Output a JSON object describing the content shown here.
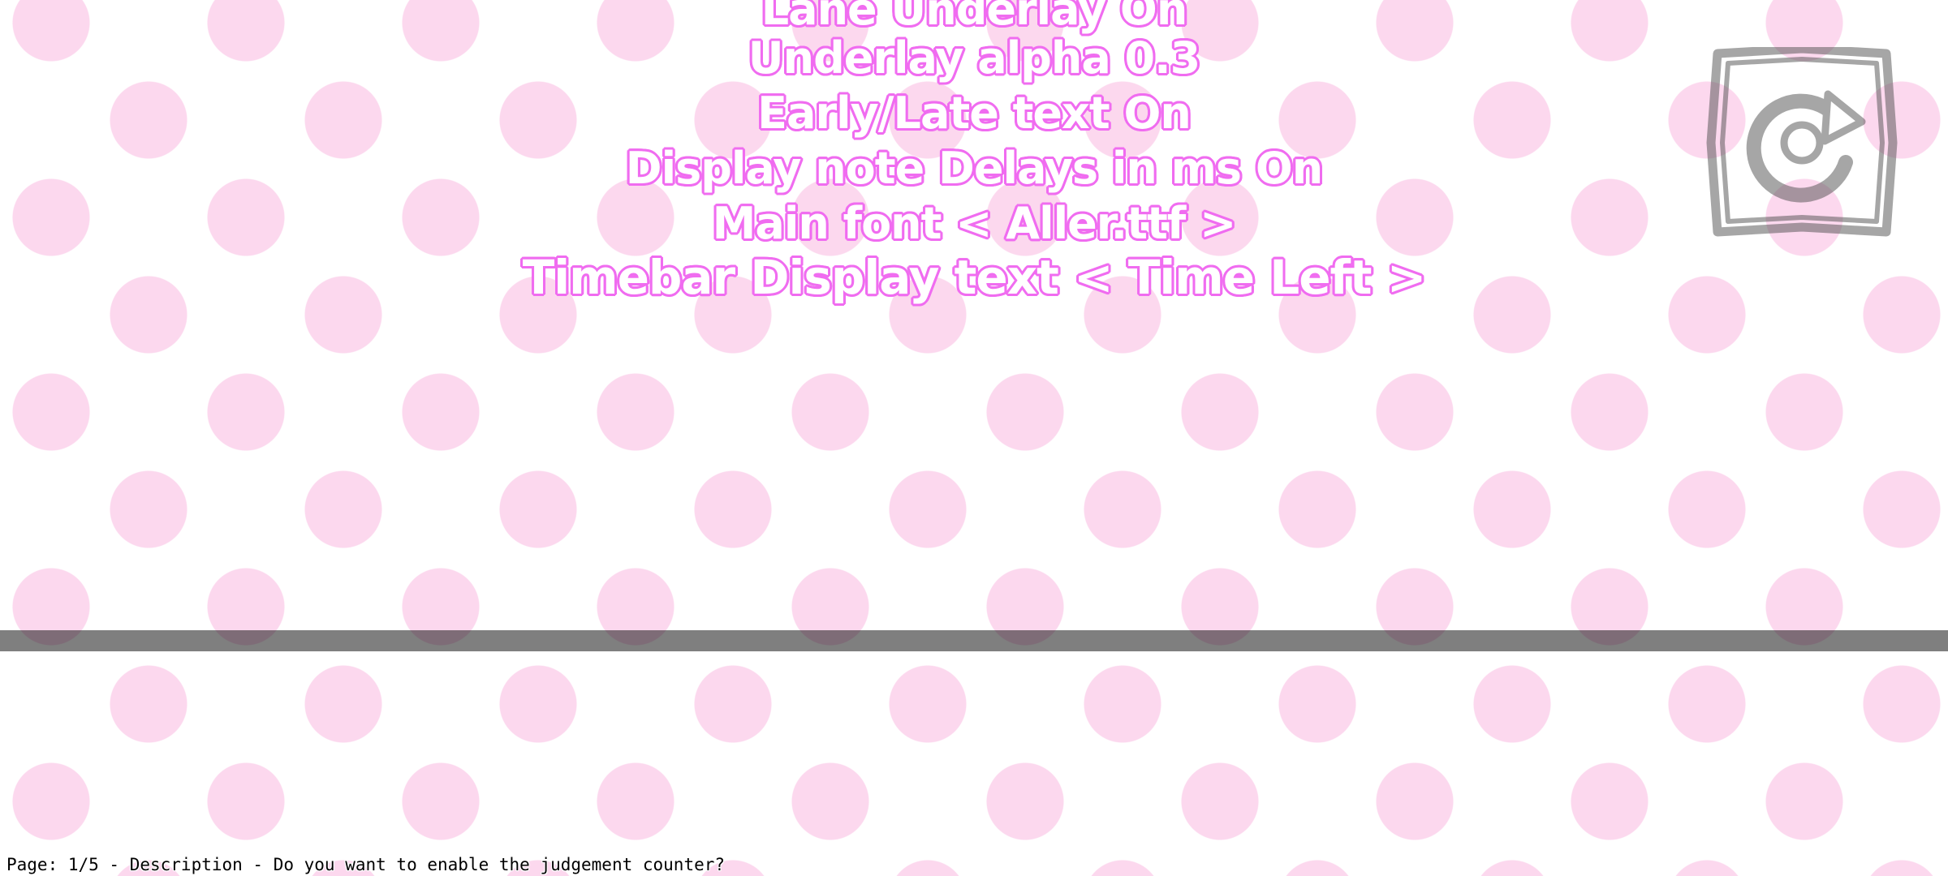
{
  "options": [
    {
      "label": "Lane Underlay On"
    },
    {
      "label": "Underlay alpha 0.3"
    },
    {
      "label": "Early/Late text On"
    },
    {
      "label": "Display note Delays in ms On"
    },
    {
      "label": "Main font < Aller.ttf >"
    },
    {
      "label": "Timebar Display text < Time Left >"
    }
  ],
  "reset_button": {
    "icon": "reset-arrow-icon"
  },
  "description": {
    "text": "Page: 1/5 - Description - Do you want to enable the judgement counter?"
  },
  "colors": {
    "dot_pink": "#fcd8ee",
    "text_outline": "#f06cf0",
    "text_fill": "#ffffff",
    "divider": "rgba(0,0,0,0.5)"
  }
}
